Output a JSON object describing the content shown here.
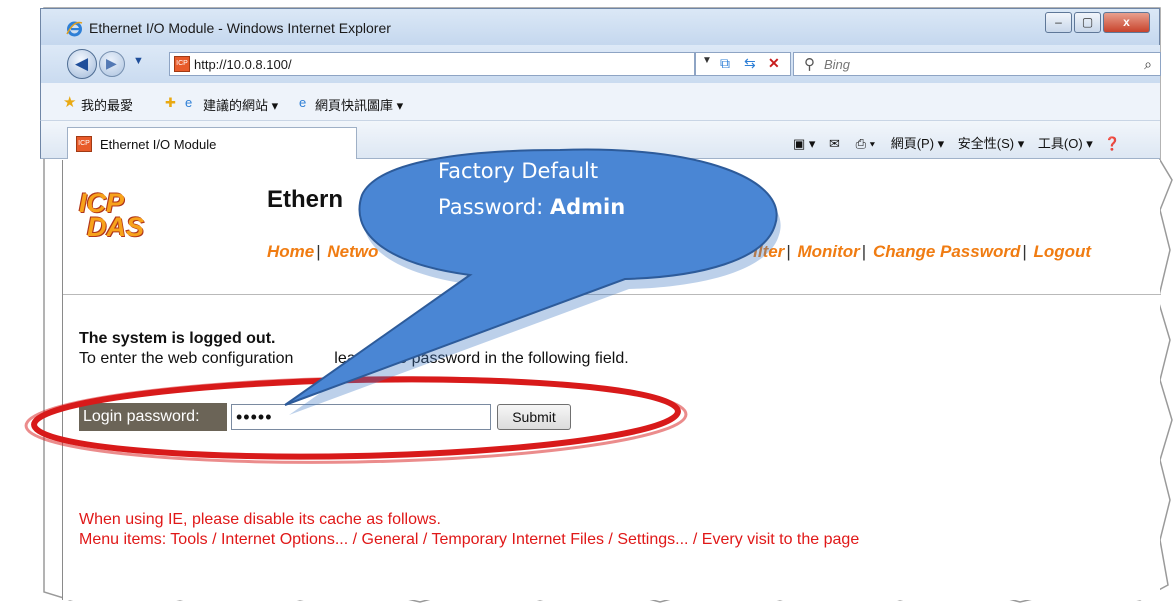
{
  "window": {
    "title": "Ethernet I/O Module - Windows Internet Explorer",
    "minimize_glyph": "–",
    "maximize_glyph": "▢",
    "close_glyph": "x"
  },
  "address_bar": {
    "url": "http://10.0.8.100/",
    "search_placeholder": "Bing",
    "favicon_text": "ICP"
  },
  "favorites_bar": {
    "favorites_label": "我的最愛",
    "suggested_sites": "建議的網站 ▾",
    "web_slice_gallery": "網頁快訊圖庫 ▾"
  },
  "tab": {
    "title": "Ethernet I/O Module"
  },
  "command_bar": {
    "page_menu": "網頁(P) ▾",
    "safety_menu": "安全性(S) ▾",
    "tools_menu": "工具(O) ▾"
  },
  "page": {
    "logo_line1": "ICP",
    "logo_line2": "DAS",
    "heading": "Ethern",
    "menu": {
      "home": "Home",
      "network": "Netwo",
      "filter": "ilter",
      "monitor": "Monitor",
      "change_password": "Change Password",
      "logout": "Logout"
    },
    "logged_out": "The system is logged out.",
    "instructions_part1": "To enter the web configuration",
    "instructions_part2": "lease type password in the following field.",
    "login_label": "Login password:",
    "password_value": "•••••",
    "submit_label": "Submit",
    "warning_line1": "When using IE, please disable its cache as follows.",
    "warning_line2": "Menu items: Tools / Internet Options... / General / Temporary Internet Files / Settings... / Every visit to the page"
  },
  "callout": {
    "line1": "Factory Default",
    "line2_prefix": "Password: ",
    "line2_bold": "Admin"
  },
  "colors": {
    "menu_link": "#f07c12",
    "warning_text": "#e01818",
    "callout_fill": "#4a86d4",
    "highlight_ellipse": "#d81a1a",
    "login_label_bg": "#6b6457"
  }
}
